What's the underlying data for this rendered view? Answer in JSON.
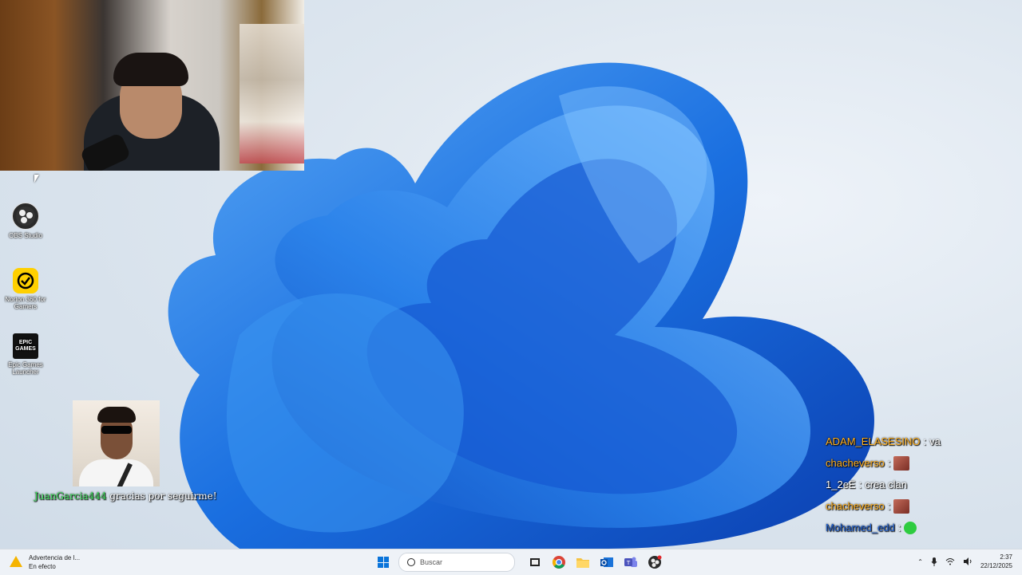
{
  "follow_alert": {
    "user": "JuanGarcia444",
    "message": "gracias por seguirme!"
  },
  "desktop_icons": [
    {
      "label": "OBS Studio",
      "icon": "obs-icon"
    },
    {
      "label": "Norton 360 for Gamers",
      "icon": "norton-icon"
    },
    {
      "label": "Epic Games Launcher",
      "icon": "epic-games-icon",
      "glyph": "EPIC GAMES"
    }
  ],
  "chat": [
    {
      "user": "ADAM_ELASESINO",
      "message": "va",
      "user_color": "#ffb020"
    },
    {
      "user": "chacheverso",
      "message": "",
      "emote": "meme-face-emote",
      "user_color": "#ffb020"
    },
    {
      "user": "1_2eE",
      "message": "crea clan",
      "user_color": "#ffffff"
    },
    {
      "user": "chacheverso",
      "message": "",
      "emote": "meme-face-emote",
      "user_color": "#ffb020"
    },
    {
      "user": "Mohamed_edd",
      "message": "",
      "emote": "green-smile-emote",
      "user_color": "#1e5fd0"
    }
  ],
  "taskbar": {
    "weather_title": "Advertencia de l...",
    "weather_status": "En efecto",
    "search_placeholder": "Buscar",
    "time": "2:37",
    "date": "22/12/2025",
    "apps": [
      "start-icon",
      "task-view-icon",
      "chrome-icon",
      "file-explorer-icon",
      "outlook-icon",
      "teams-icon",
      "obs-taskbar-icon"
    ]
  },
  "colors": {
    "accent": "#0a74da",
    "wallpaper_blue": "#1a6fe0",
    "follow_user": "#3fdc5d"
  }
}
